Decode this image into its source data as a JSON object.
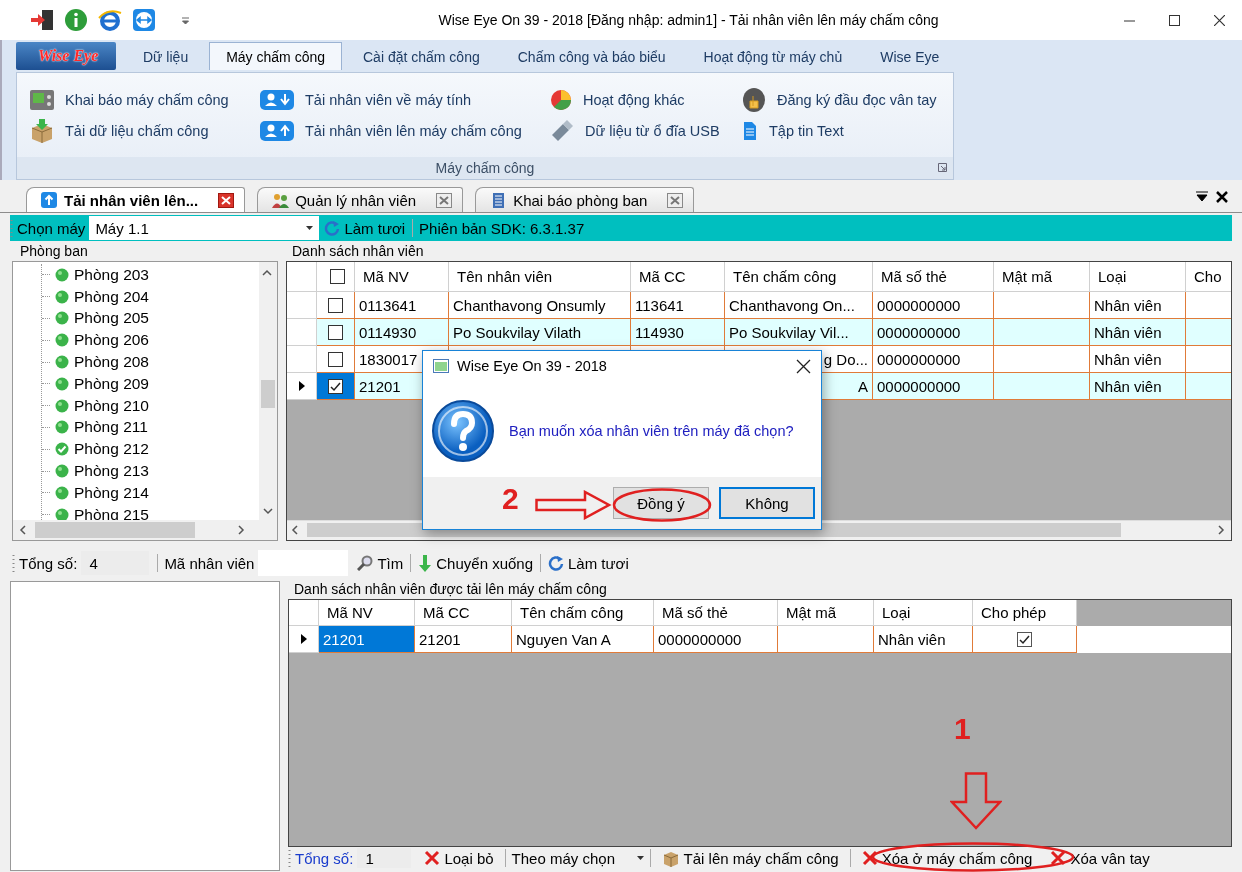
{
  "window": {
    "title": "Wise Eye On 39 - 2018 [Đăng nhập: admin1] - Tải nhân viên lên máy chấm công"
  },
  "ribbon": {
    "logo": "Wise Eye",
    "tabs": [
      {
        "label": "Dữ liệu",
        "selected": false
      },
      {
        "label": "Máy chấm công",
        "selected": true
      },
      {
        "label": "Cài đặt chấm công",
        "selected": false
      },
      {
        "label": "Chấm công và báo biểu",
        "selected": false
      },
      {
        "label": "Hoạt động từ máy chủ",
        "selected": false
      },
      {
        "label": "Wise Eye",
        "selected": false
      }
    ],
    "group": {
      "label": "Máy chấm công",
      "items": [
        {
          "label": "Khai báo máy chấm công",
          "kind": "device"
        },
        {
          "label": "Tải dữ liệu chấm công",
          "kind": "package"
        },
        {
          "label": "Tải nhân viên về máy tính",
          "kind": "user-down"
        },
        {
          "label": "Tải nhân viên lên máy chấm công",
          "kind": "user-up"
        },
        {
          "label": "Hoạt động khác",
          "kind": "pie"
        },
        {
          "label": "Dữ liệu từ ổ đĩa USB",
          "kind": "usb"
        },
        {
          "label": "Đăng ký đầu đọc vân tay",
          "kind": "finger"
        },
        {
          "label": "Tập tin Text",
          "kind": "file"
        }
      ]
    }
  },
  "doc_tabs": [
    {
      "label": "Tải nhân viên lên...",
      "selected": true,
      "kind": "upload"
    },
    {
      "label": "Quản lý nhân viên",
      "selected": false,
      "kind": "people"
    },
    {
      "label": "Khai báo phòng ban",
      "selected": false,
      "kind": "building"
    }
  ],
  "machine_bar": {
    "label": "Chọn máy",
    "value": "Máy 1.1",
    "refresh": "Làm tươi",
    "sdk": "Phiên bản SDK: 6.3.1.37"
  },
  "departments": {
    "title": "Phòng ban",
    "items": [
      {
        "label": "Phòng 203",
        "checked": false
      },
      {
        "label": "Phòng 204",
        "checked": false
      },
      {
        "label": "Phòng 205",
        "checked": false
      },
      {
        "label": "Phòng 206",
        "checked": false
      },
      {
        "label": "Phòng 208",
        "checked": false
      },
      {
        "label": "Phòng 209",
        "checked": false
      },
      {
        "label": "Phòng 210",
        "checked": false
      },
      {
        "label": "Phòng 211",
        "checked": false
      },
      {
        "label": "Phòng 212",
        "checked": true
      },
      {
        "label": "Phòng 213",
        "checked": false
      },
      {
        "label": "Phòng 214",
        "checked": false
      },
      {
        "label": "Phòng 215",
        "checked": false
      }
    ]
  },
  "employees": {
    "title": "Danh sách nhân viên",
    "all_checked": false,
    "columns": [
      "Mã NV",
      "Tên nhân viên",
      "Mã CC",
      "Tên chấm công",
      "Mã số thẻ",
      "Mật mã",
      "Loại",
      "Cho"
    ],
    "rows": [
      {
        "current": false,
        "selected": false,
        "checked": false,
        "cells": [
          "0113641",
          "Chanthavong Onsumly",
          "113641",
          "Chanthavong On...",
          "0000000000",
          null,
          "Nhân viên",
          null
        ]
      },
      {
        "current": false,
        "selected": false,
        "checked": false,
        "cells": [
          "0114930",
          "Po Soukvilay Vilath",
          "114930",
          "Po Soukvilay Vil...",
          "0000000000",
          null,
          "Nhân viên",
          null
        ]
      },
      {
        "current": false,
        "selected": false,
        "checked": false,
        "cells": [
          "1830017",
          null,
          null,
          "g Do...",
          "0000000000",
          null,
          "Nhân viên",
          null
        ],
        "covered": true
      },
      {
        "current": true,
        "selected": true,
        "checked": true,
        "cells": [
          "21201",
          null,
          null,
          "A",
          "0000000000",
          null,
          "Nhân viên",
          null
        ],
        "covered": true
      }
    ]
  },
  "search_bar": {
    "total_label": "Tổng số:",
    "total": "4",
    "search_label": "Mã nhân viên",
    "find": "Tìm",
    "move_down": "Chuyển xuống",
    "refresh": "Làm tươi"
  },
  "uploaded": {
    "title": "Danh sách nhân viên được tải lên máy chấm công",
    "columns": [
      "Mã NV",
      "Mã CC",
      "Tên chấm công",
      "Mã số thẻ",
      "Mật mã",
      "Loại",
      "Cho phép"
    ],
    "rows": [
      {
        "current": true,
        "selected": true,
        "allowed": true,
        "cells": [
          "21201",
          "21201",
          "Nguyen Van A",
          "0000000000",
          null,
          "Nhân viên"
        ]
      }
    ]
  },
  "bottom_bar": {
    "total_label": "Tổng số:",
    "total": "1",
    "remove": "Loại bỏ",
    "filter": "Theo máy chọn",
    "upload": "Tải lên máy chấm công",
    "delete_on_device": "Xóa ở máy chấm công",
    "delete_fingerprint": "Xóa vân tay"
  },
  "dialog": {
    "title": "Wise Eye On 39 - 2018",
    "message": "Bạn muốn xóa nhân viên trên máy đã chọn?",
    "buttons": [
      {
        "label": "Đồng ý",
        "focused": false
      },
      {
        "label": "Không",
        "focused": true
      }
    ]
  },
  "annotations": [
    {
      "label": "2"
    },
    {
      "label": "1"
    }
  ]
}
